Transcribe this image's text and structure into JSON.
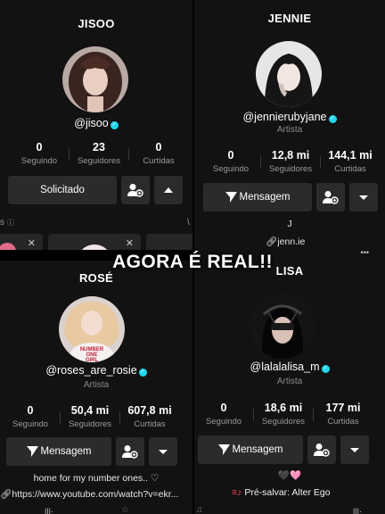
{
  "overlay_title": "AGORA É REAL!!",
  "jisoo": {
    "handle": "JISOO",
    "username": "@jisoo",
    "stats": [
      {
        "value": "0",
        "label": "Seguindo"
      },
      {
        "value": "23",
        "label": "Seguidores"
      },
      {
        "value": "0",
        "label": "Curtidas"
      }
    ],
    "primary_button": "Solicitado",
    "partial_text_left": "s",
    "partial_text_right": "\\"
  },
  "jennie": {
    "handle": "JENNIE",
    "username": "@jennierubyjane",
    "category": "Artista",
    "stats": [
      {
        "value": "0",
        "label": "Seguindo"
      },
      {
        "value": "12,8 mi",
        "label": "Seguidores"
      },
      {
        "value": "144,1 mi",
        "label": "Curtidas"
      }
    ],
    "primary_button": "Mensagem",
    "bio": "J",
    "link": "jenn.ie",
    "more": "•••"
  },
  "rose": {
    "handle": "ROSÉ",
    "username": "@roses_are_rosie",
    "category": "Artista",
    "avatar_shirt": "NUMBER ONE GIRL",
    "stats": [
      {
        "value": "0",
        "label": "Seguindo"
      },
      {
        "value": "50,4 mi",
        "label": "Seguidores"
      },
      {
        "value": "607,8 mi",
        "label": "Curtidas"
      }
    ],
    "primary_button": "Mensagem",
    "bio": "home for my number ones.. ♡",
    "link": "https://www.youtube.com/watch?v=ekr..."
  },
  "lisa": {
    "handle": "LISA",
    "username": "@lalalalisa_m",
    "category": "Artista",
    "stats": [
      {
        "value": "0",
        "label": "Seguindo"
      },
      {
        "value": "18,6 mi",
        "label": "Seguidores"
      },
      {
        "value": "177 mi",
        "label": "Curtidas"
      }
    ],
    "primary_button": "Mensagem",
    "bio": "🖤🩷",
    "link": "Pré-salvar: Alter Ego"
  }
}
